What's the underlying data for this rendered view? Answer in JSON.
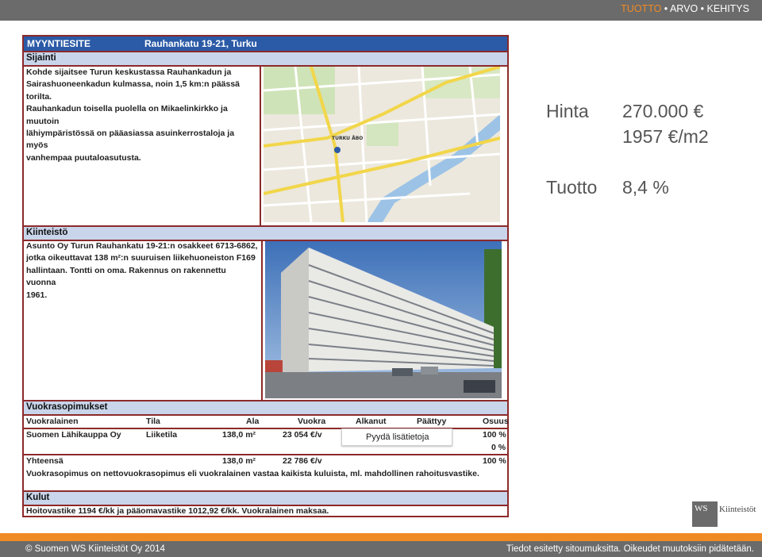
{
  "topnav": {
    "item1": "TUOTTO",
    "sep1": " • ",
    "item2": "ARVO",
    "sep2": " • ",
    "item3": "KEHITYS"
  },
  "sheet": {
    "title": "MYYNTIESITE",
    "address": "Rauhankatu 19-21, Turku",
    "sijainti": {
      "header": "Sijainti",
      "lines": [
        "Kohde sijaitsee Turun keskustassa Rauhankadun ja",
        "Sairashuoneenkadun kulmassa, noin 1,5 km:n päässä torilta.",
        "Rauhankadun toisella puolella on Mikaelinkirkko ja muutoin",
        "lähiympäristössä on pääasiassa asuinkerrostaloja ja myös",
        "vanhempaa puutaloasutusta."
      ],
      "map_label": "TURKU ÅBO"
    },
    "kiinteisto": {
      "header": "Kiinteistö",
      "lines": [
        "Asunto Oy Turun Rauhankatu 19-21:n osakkeet 6713-6862,",
        "jotka oikeuttavat 138 m²:n suuruisen liikehuoneiston F169",
        "hallintaan. Tontti on oma. Rakennus on rakennettu vuonna",
        "1961."
      ]
    },
    "vuokra": {
      "header": "Vuokrasopimukset",
      "columns": [
        "Vuokralainen",
        "Tila",
        "Ala",
        "Vuokra",
        "Alkanut",
        "Päättyy",
        "Osuus"
      ],
      "row": {
        "tenant": "Suomen Lähikauppa Oy",
        "tila": "Liiketila",
        "ala": "138,0 m²",
        "vuokra": "23 054 €/v",
        "osuus": "100 %"
      },
      "row2_osuus": "0 %",
      "total": {
        "label": "Yhteensä",
        "ala": "138,0 m²",
        "vuokra": "22 786 €/v",
        "osuus": "100 %"
      },
      "note": "Vuokrasopimus on nettovuokrasopimus eli vuokralainen vastaa kaikista kuluista, ml. mahdollinen rahoitusvastike."
    },
    "kulut": {
      "header": "Kulut",
      "text": "Hoitovastike 1194 €/kk ja pääomavastike 1012,92 €/kk. Vuokralainen maksaa."
    }
  },
  "note_button": "Pyydä lisätietoja",
  "summary": {
    "hinta_label": "Hinta",
    "hinta_value": "270.000 €",
    "per_m2": "1957 €/m2",
    "tuotto_label": "Tuotto",
    "tuotto_value": "8,4 %"
  },
  "logo": {
    "mark": "WS",
    "text": "Kiinteistöt"
  },
  "footer": {
    "left": "© Suomen WS Kiinteistöt Oy 2014",
    "right": "Tiedot esitetty sitoumuksitta. Oikeudet muutoksiin pidätetään."
  },
  "colors": {
    "accent": "#f08a24",
    "bar": "#6b6b6b",
    "header_blue": "#2b5aa6",
    "section_bg": "#c9d5ea",
    "border": "#8c2a2a"
  }
}
